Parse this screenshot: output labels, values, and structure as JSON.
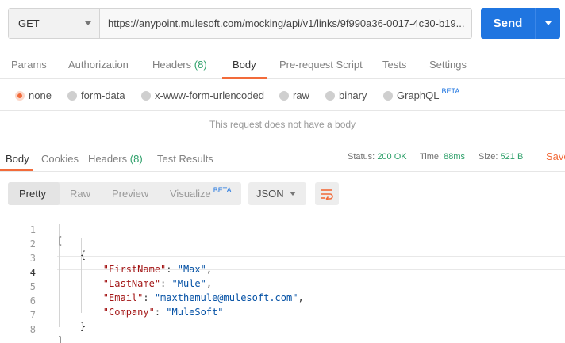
{
  "request": {
    "method": "GET",
    "url": "https://anypoint.mulesoft.com/mocking/api/v1/links/9f990a36-0017-4c30-b19...",
    "send_label": "Send"
  },
  "request_tabs": [
    {
      "label": "Params"
    },
    {
      "label": "Authorization"
    },
    {
      "label": "Headers",
      "count": "(8)"
    },
    {
      "label": "Body",
      "active": true
    },
    {
      "label": "Pre-request Script"
    },
    {
      "label": "Tests"
    },
    {
      "label": "Settings"
    }
  ],
  "body_types": [
    {
      "label": "none",
      "selected": true
    },
    {
      "label": "form-data"
    },
    {
      "label": "x-www-form-urlencoded"
    },
    {
      "label": "raw"
    },
    {
      "label": "binary"
    },
    {
      "label": "GraphQL",
      "badge": "BETA"
    }
  ],
  "no_body_message": "This request does not have a body",
  "response_tabs": [
    {
      "label": "Body",
      "active": true
    },
    {
      "label": "Cookies"
    },
    {
      "label": "Headers",
      "count": "(8)"
    },
    {
      "label": "Test Results"
    }
  ],
  "status": {
    "status_label": "Status:",
    "status_value": "200 OK",
    "time_label": "Time:",
    "time_value": "88ms",
    "size_label": "Size:",
    "size_value": "521 B",
    "save_label": "Save"
  },
  "view_modes": [
    {
      "label": "Pretty",
      "active": true
    },
    {
      "label": "Raw"
    },
    {
      "label": "Preview"
    },
    {
      "label": "Visualize",
      "badge": "BETA"
    }
  ],
  "format": "JSON",
  "icons": {
    "method_caret": "chevron-down-icon",
    "send_caret": "chevron-down-icon",
    "wrap": "wrap-lines-icon"
  },
  "colors": {
    "accent": "#f26b3a",
    "primary": "#1f75e0",
    "success": "#2ea06a"
  },
  "code_lines": [
    {
      "n": "1",
      "text": "["
    },
    {
      "n": "2",
      "text": "    {"
    },
    {
      "n": "3",
      "key": "\"FirstName\"",
      "value": "\"Max\"",
      "tail": ","
    },
    {
      "n": "4",
      "key": "\"LastName\"",
      "value": "\"Mule\"",
      "tail": ","
    },
    {
      "n": "5",
      "key": "\"Email\"",
      "value": "\"maxthemule@mulesoft.com\"",
      "tail": ","
    },
    {
      "n": "6",
      "key": "\"Company\"",
      "value": "\"MuleSoft\"",
      "tail": ""
    },
    {
      "n": "7",
      "text": "    }"
    },
    {
      "n": "8",
      "text": "]"
    }
  ]
}
